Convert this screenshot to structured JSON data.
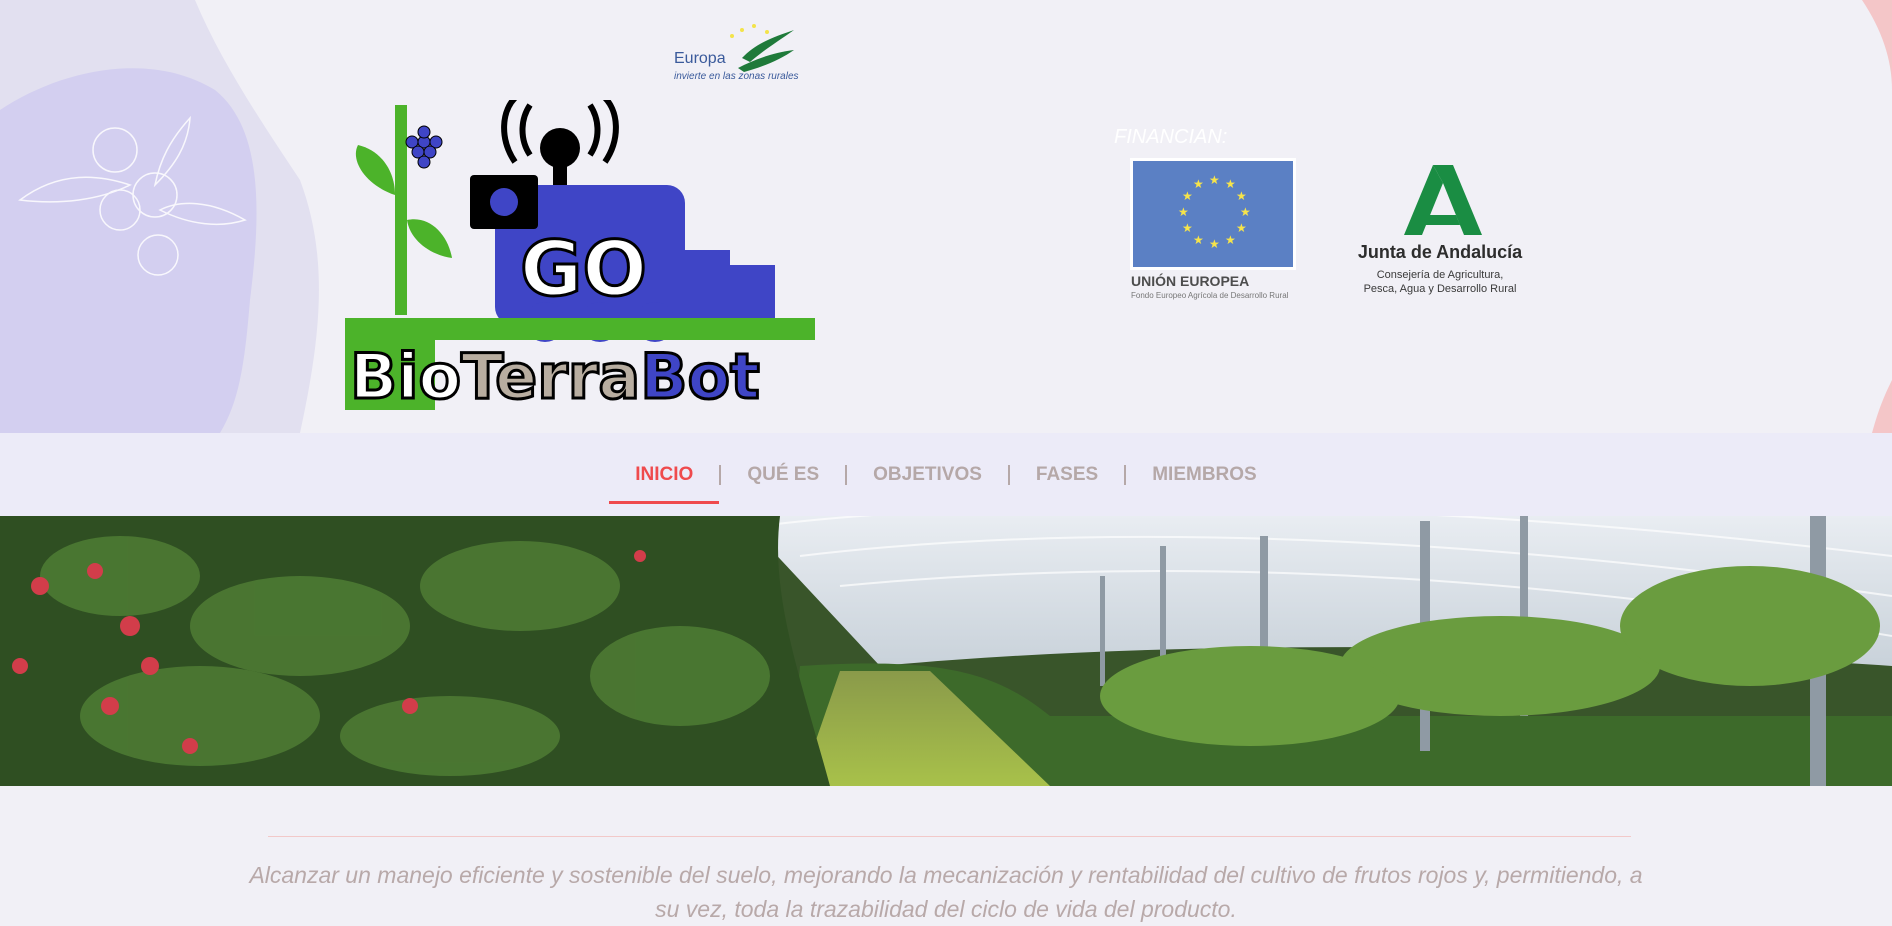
{
  "header": {
    "europa_word": "Europa",
    "europa_sub": "invierte en las zonas rurales",
    "logo_go": "GO",
    "logo_text": [
      "Bio",
      "Terra",
      "Bot"
    ],
    "financian": "FINANCIAN:",
    "eu_name": "UNIÓN EUROPEA",
    "eu_sub": "Fondo Europeo Agrícola de Desarrollo Rural",
    "junta_name": "Junta de Andalucía",
    "junta_sub_1": "Consejería de Agricultura,",
    "junta_sub_2": "Pesca, Agua y Desarrollo Rural"
  },
  "nav": {
    "items": [
      {
        "label": "INICIO",
        "active": true
      },
      {
        "label": "QUÉ ES",
        "active": false
      },
      {
        "label": "OBJETIVOS",
        "active": false
      },
      {
        "label": "FASES",
        "active": false
      },
      {
        "label": "MIEMBROS",
        "active": false
      }
    ]
  },
  "hero": {
    "icon": "raspberry-greenhouse-photo"
  },
  "main": {
    "tagline": "Alcanzar un manejo eficiente y sostenible del suelo, mejorando la mecanización y rentabilidad del cultivo de frutos rojos y, permitiendo, a su vez, toda la trazabilidad del ciclo de vida del producto."
  },
  "colors": {
    "accent": "#ef4a4d",
    "nav_text": "#b5a8a8",
    "logo_blue": "#3f45c6",
    "logo_green": "#4cb32a"
  }
}
